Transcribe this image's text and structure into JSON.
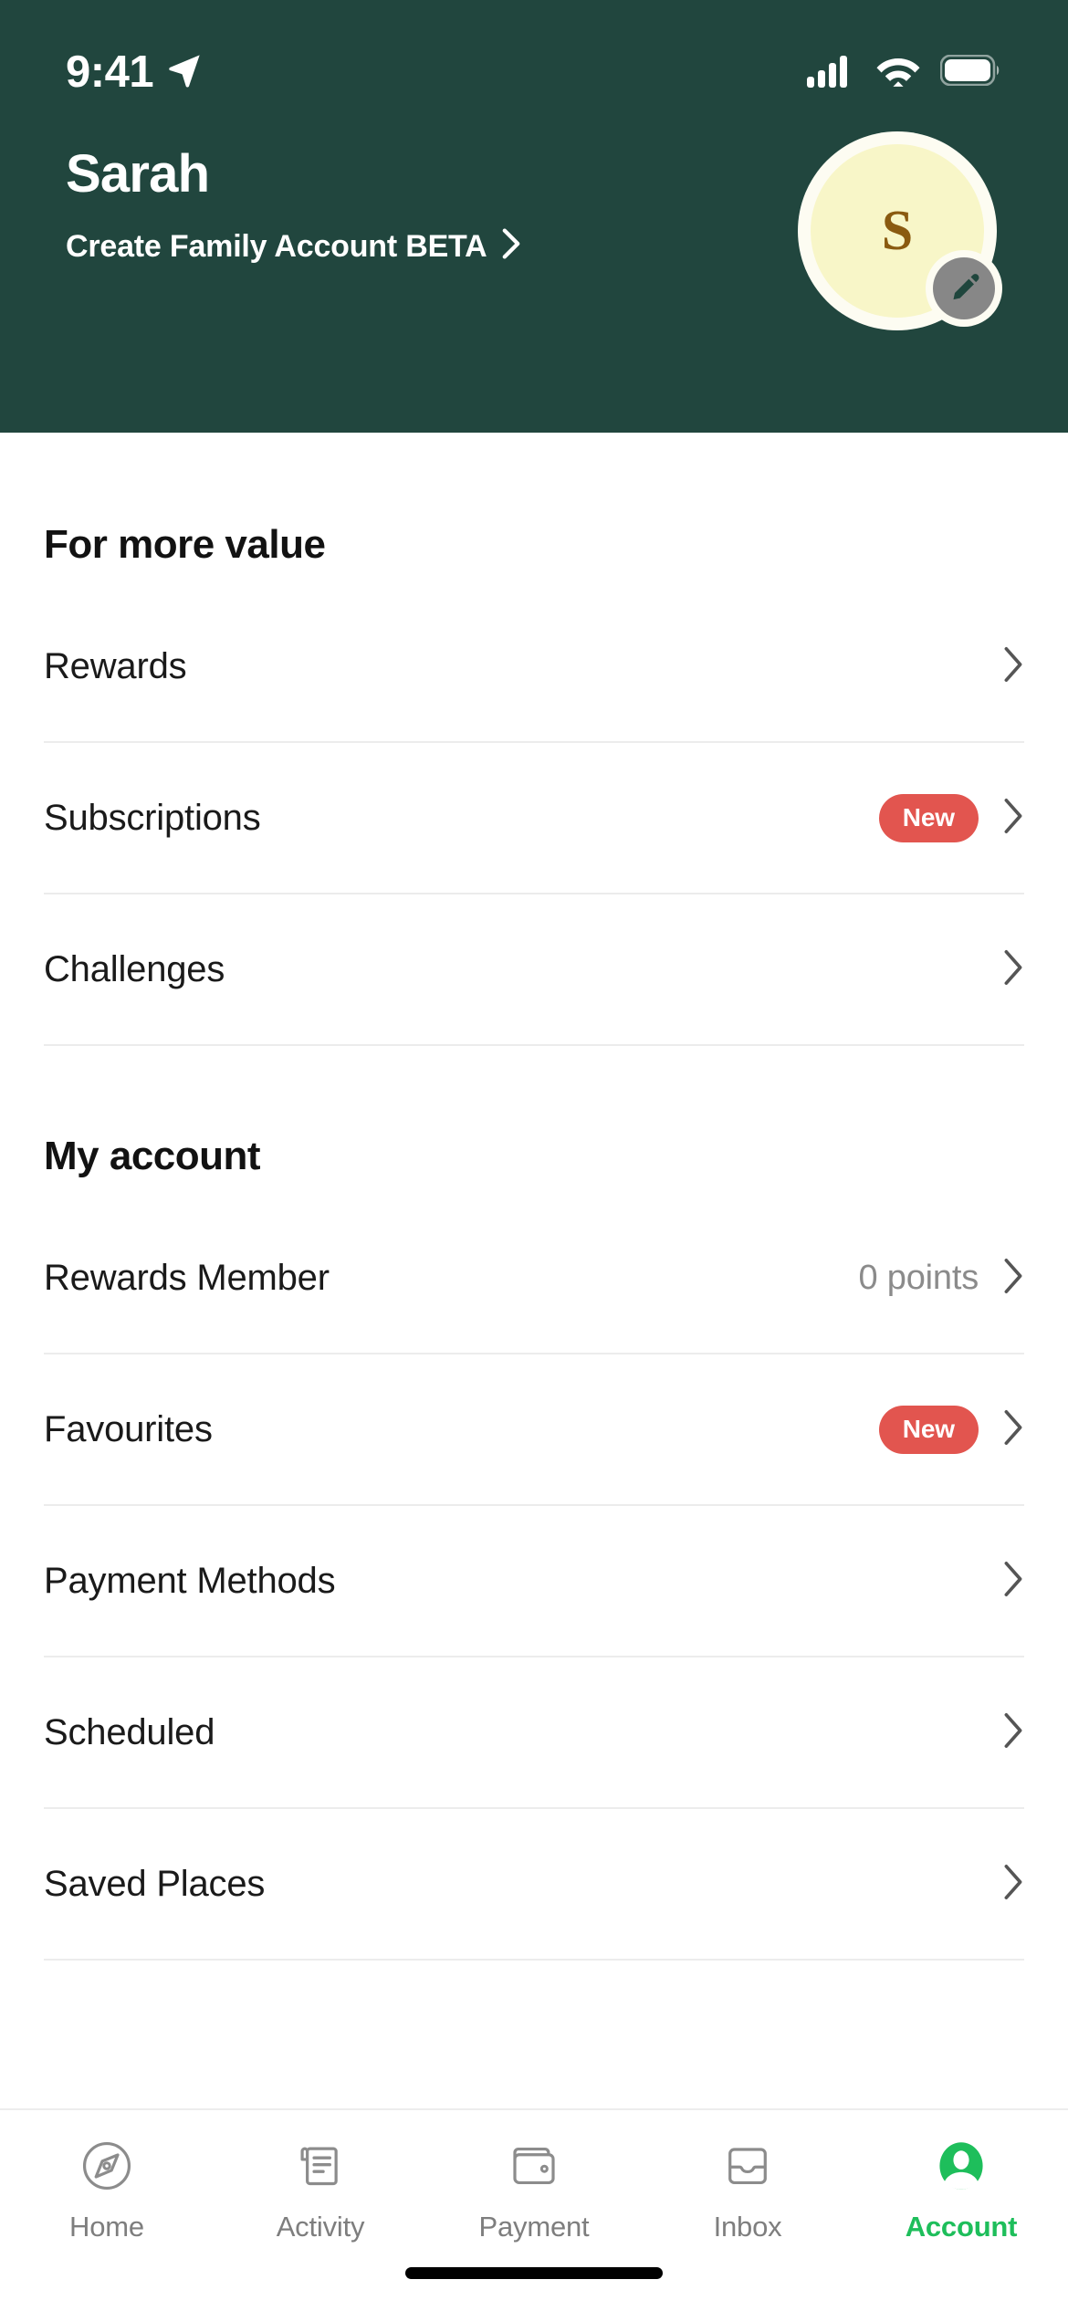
{
  "status_bar": {
    "time": "9:41",
    "location_icon": "location-arrow-icon",
    "signal_icon": "cellular-signal-icon",
    "wifi_icon": "wifi-icon",
    "battery_icon": "battery-full-icon"
  },
  "header": {
    "name": "Sarah",
    "family_account_link": "Create Family Account BETA",
    "chevron_icon": "chevron-right-icon",
    "avatar_initial": "S",
    "edit_icon": "pencil-edit-icon",
    "background_color": "#21463E",
    "avatar_bg_color": "#F8F6C8",
    "avatar_text_color": "#8A5A10"
  },
  "sections": [
    {
      "title": "For more value",
      "rows": [
        {
          "label": "Rewards",
          "value": "",
          "badge": "",
          "chevron_icon": "chevron-right-icon"
        },
        {
          "label": "Subscriptions",
          "value": "",
          "badge": "New",
          "chevron_icon": "chevron-right-icon"
        },
        {
          "label": "Challenges",
          "value": "",
          "badge": "",
          "chevron_icon": "chevron-right-icon"
        }
      ]
    },
    {
      "title": "My account",
      "rows": [
        {
          "label": "Rewards Member",
          "value": "0 points",
          "badge": "",
          "chevron_icon": "chevron-right-icon"
        },
        {
          "label": "Favourites",
          "value": "",
          "badge": "New",
          "chevron_icon": "chevron-right-icon"
        },
        {
          "label": "Payment Methods",
          "value": "",
          "badge": "",
          "chevron_icon": "chevron-right-icon"
        },
        {
          "label": "Scheduled",
          "value": "",
          "badge": "",
          "chevron_icon": "chevron-right-icon"
        },
        {
          "label": "Saved Places",
          "value": "",
          "badge": "",
          "chevron_icon": "chevron-right-icon"
        }
      ]
    }
  ],
  "badge_color": "#E2554F",
  "tabbar": {
    "active_color": "#1EBE5B",
    "inactive_color": "#7E7E7E",
    "tabs": [
      {
        "label": "Home",
        "icon": "compass-icon",
        "active": false
      },
      {
        "label": "Activity",
        "icon": "receipt-icon",
        "active": false
      },
      {
        "label": "Payment",
        "icon": "wallet-icon",
        "active": false
      },
      {
        "label": "Inbox",
        "icon": "inbox-tray-icon",
        "active": false
      },
      {
        "label": "Account",
        "icon": "person-filled-icon",
        "active": true
      }
    ]
  }
}
